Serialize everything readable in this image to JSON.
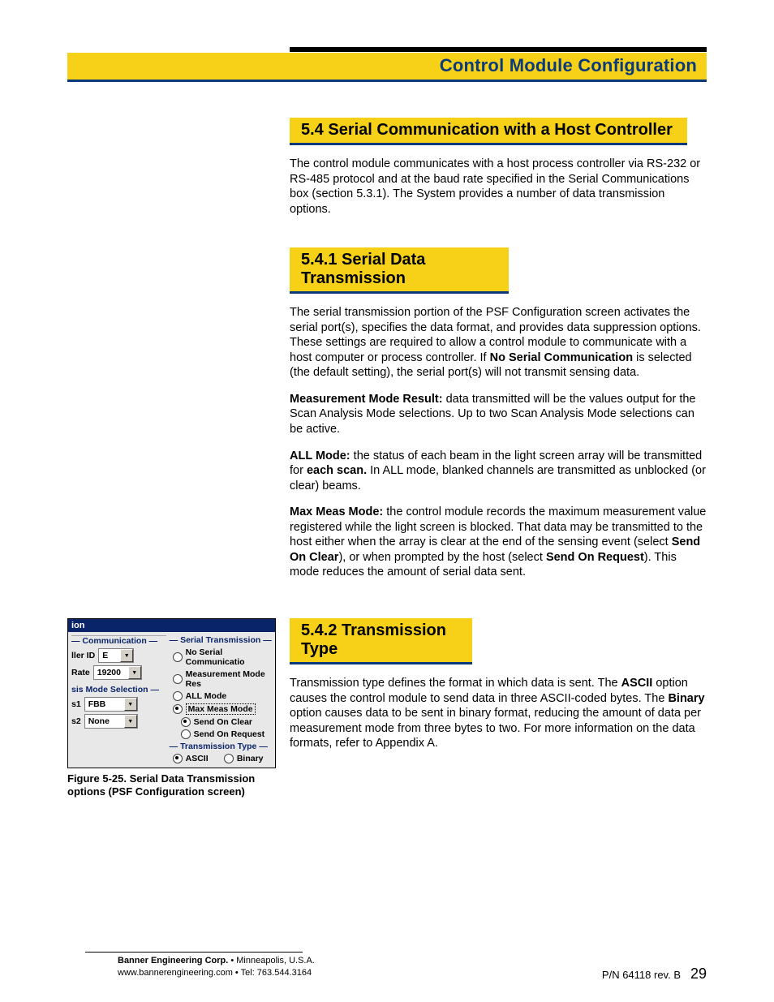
{
  "header": {
    "title": "Control Module Configuration"
  },
  "sections": {
    "s54": {
      "heading": "5.4 Serial Communication with a Host Controller",
      "p1": "The control module communicates with a host process controller via RS-232 or RS-485 protocol and at the baud rate specified in the Serial Communications box (section 5.3.1). The System provides a number of data transmission options."
    },
    "s541": {
      "heading": "5.4.1 Serial Data Transmission",
      "p1a": "The serial transmission portion of the PSF Configuration screen activates the serial port(s), specifies the data format, and provides data suppression options. These settings are required to allow a control module to communicate with a host computer or process controller. If ",
      "p1b": "No Serial Communication",
      "p1c": " is selected (the default setting), the serial port(s) will not transmit sensing data.",
      "p2b": "Measurement Mode Result:",
      "p2": " data transmitted will be the values output for the Scan Analysis Mode selections. Up to two Scan Analysis Mode selections can be active.",
      "p3b": "ALL Mode:",
      "p3a": " the status of each beam in the light screen array will be transmitted for ",
      "p3c": "each scan.",
      "p3d": "  In ALL mode, blanked channels are transmitted as unblocked (or clear) beams.",
      "p4b": "Max Meas Mode:",
      "p4a": " the control module records the maximum measurement value registered while the light screen is blocked. That data may be transmitted to the host either when the array is clear at the end of the sensing event (select ",
      "p4c": "Send On Clear",
      "p4d": "), or when prompted by the host (select ",
      "p4e": "Send On Request",
      "p4f": "). This mode reduces the amount of serial data sent."
    },
    "s542": {
      "heading": "5.4.2 Transmission Type",
      "p1a": "Transmission type defines the format in which data is sent. The ",
      "p1b": "ASCII",
      "p1c": " option causes the control module to send data in three ASCII-coded bytes. The ",
      "p1d": "Binary",
      "p1e": " option causes data to be sent in binary format, reducing the amount of data per measurement mode from three bytes to two. For more information on the data formats, refer to Appendix A."
    }
  },
  "figure": {
    "win_title": "ion",
    "grp_comm": "Communication",
    "lbl_id": "ller ID",
    "val_id": "E",
    "lbl_rate": "Rate",
    "val_rate": "19200",
    "grp_mode": "sis Mode Selection",
    "lbl_s1": "s1",
    "val_s1": "FBB",
    "lbl_s2": "s2",
    "val_s2": "None",
    "grp_serial": "Serial Transmission",
    "opt_no": "No Serial Communicatio",
    "opt_meas": "Measurement Mode Res",
    "opt_all": "ALL Mode",
    "opt_max": "Max Meas Mode",
    "opt_clear": "Send On Clear",
    "opt_req": "Send On Request",
    "grp_type": "Transmission Type",
    "opt_ascii": "ASCII",
    "opt_bin": "Binary",
    "caption_a": "Figure 5-25.  ",
    "caption_b": "Serial Data Transmission options (PSF Configuration screen)"
  },
  "footer": {
    "company": "Banner Engineering Corp.",
    "loc": " • Minneapolis, U.S.A.",
    "web": "www.bannerengineering.com  •  Tel: 763.544.3164",
    "pn": "P/N 64118 rev. B",
    "page": "29"
  }
}
